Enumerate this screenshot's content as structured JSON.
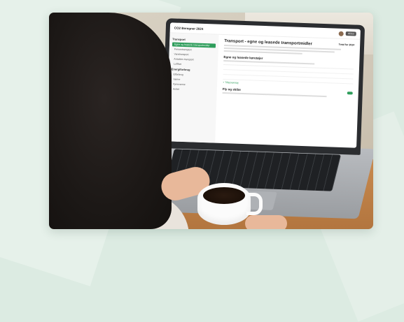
{
  "screen": {
    "brand": "CO2 Beregner 2024",
    "topbar_button": "Afslut",
    "sidebar": {
      "section_1": "Transport",
      "items_1": [
        "Egne og leasede transportmidler",
        "Persontransport",
        "Varetransport",
        "Ansattes transport",
        "Luftfart"
      ],
      "section_2": "Energiforbrug",
      "items_2": [
        "Elforbrug",
        "Varme",
        "Fjernvarme",
        "Andet"
      ]
    },
    "main": {
      "title": "Transport - egne og leasede transportmidler",
      "title_meta": "Total for 2024",
      "section_1": "Egne og leasede køretøjer",
      "add_link": "+ Tilføj køretøj",
      "section_2": "Fly og skibe"
    }
  }
}
